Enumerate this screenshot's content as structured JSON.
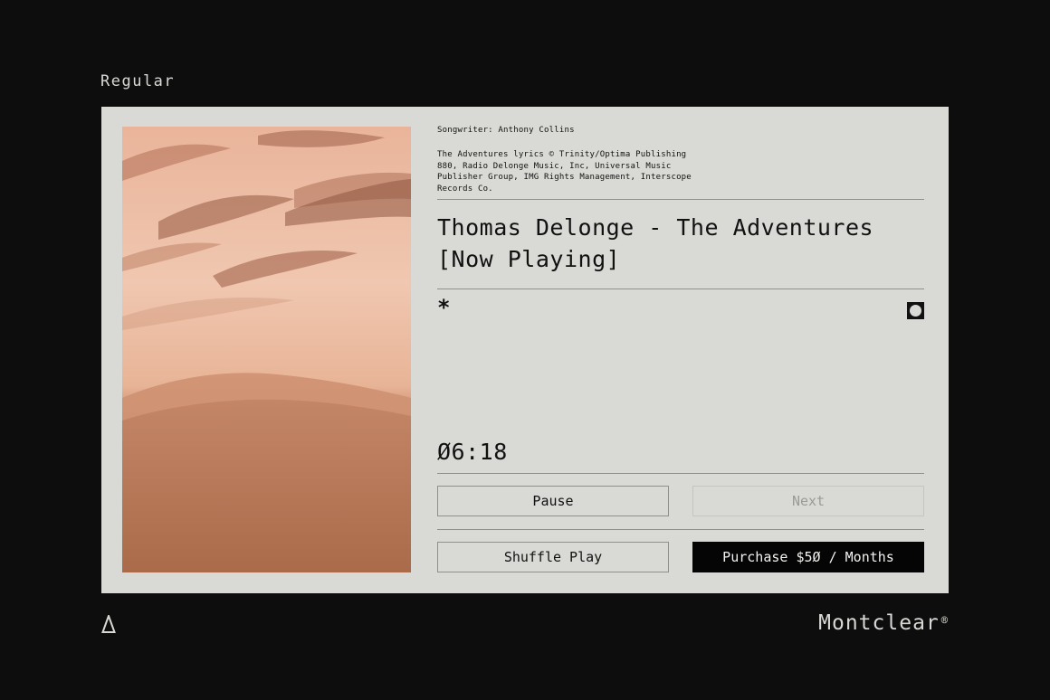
{
  "page": {
    "top_label": "Regular",
    "brand": "Montclear",
    "brand_mark": "®"
  },
  "track": {
    "songwriter": "Songwriter: Anthony Collins",
    "credits": "The Adventures lyrics © Trinity/Optima Publishing 880, Radio Delonge Music, Inc, Universal Music Publisher Group, IMG Rights Management, Interscope Records Co.",
    "title_line1": "Thomas Delonge - The Adventures",
    "title_line2": "[Now Playing]",
    "marker": "*",
    "time": "Ø6:18"
  },
  "controls": {
    "pause_label": "Pause",
    "next_label": "Next",
    "shuffle_label": "Shuffle Play",
    "purchase_label": "Purchase $5Ø / Months"
  },
  "icons": {
    "album_art": "desert-dunes-image",
    "toggle": "radio-circle-icon",
    "bottom_left": "triangle-logo-icon"
  },
  "colors": {
    "background": "#0d0d0d",
    "card": "#d9dad5",
    "primary_button": "#050505",
    "disabled_text": "#9a9b97",
    "sand": "#e4a98a"
  }
}
